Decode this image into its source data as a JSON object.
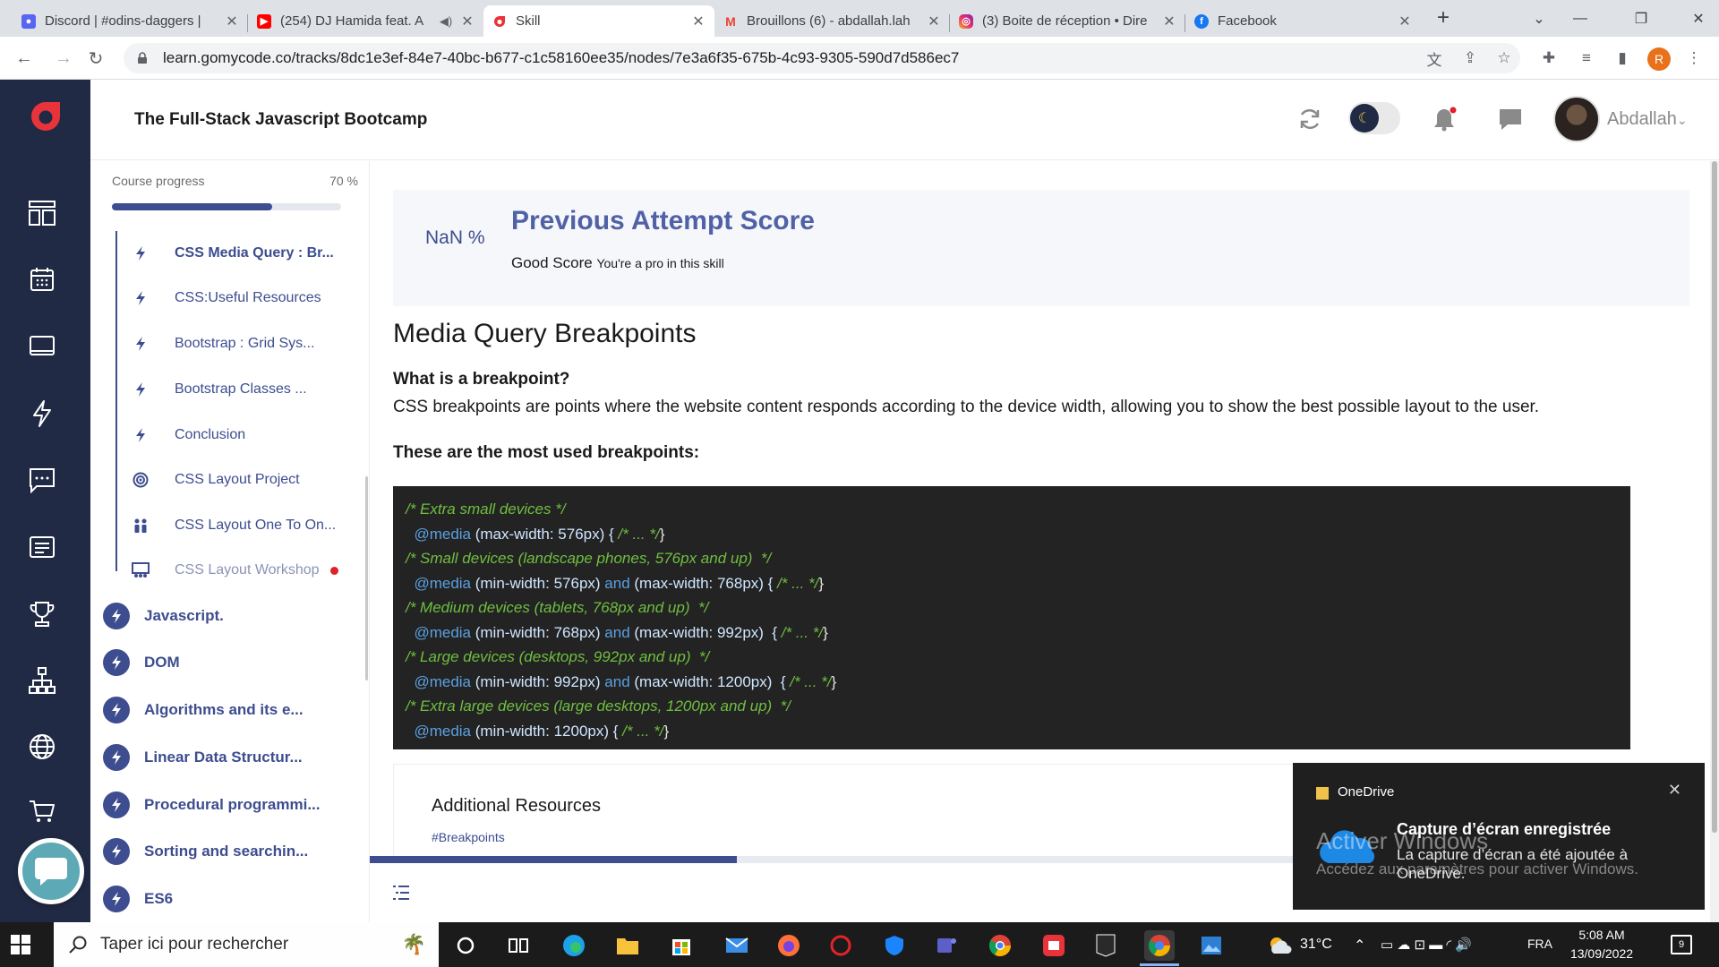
{
  "browser": {
    "tabs": [
      {
        "title": "Discord | #odins-daggers | ",
        "icon": "discord-icon"
      },
      {
        "title": "(254) DJ Hamida feat. A",
        "icon": "youtube-icon"
      },
      {
        "title": "Skill",
        "icon": "gomycode-icon"
      },
      {
        "title": "Brouillons (6) - abdallah.lah",
        "icon": "gmail-icon"
      },
      {
        "title": "(3) Boite de réception • Dire",
        "icon": "instagram-icon"
      },
      {
        "title": "Facebook",
        "icon": "facebook-icon"
      }
    ],
    "url": "learn.gomycode.co/tracks/8dc1e3ef-84e7-40bc-b677-c1c58160ee35/nodes/7e3a6f35-675b-4c93-9305-590d7d586ec7",
    "profile_initial": "R"
  },
  "header": {
    "course_title": "The Full-Stack Javascript Bootcamp",
    "user_name": "Abdallah"
  },
  "sidebar": {
    "progress_label": "Course progress",
    "progress_text": "70 %",
    "progress_value": 0.7,
    "sub_items": [
      {
        "label": "CSS Media Query : Br...",
        "icon": "bolt-icon",
        "current": true
      },
      {
        "label": "CSS:Useful Resources",
        "icon": "bolt-icon"
      },
      {
        "label": "Bootstrap : Grid Sys...",
        "icon": "bolt-icon"
      },
      {
        "label": "Bootstrap Classes ...",
        "icon": "bolt-icon"
      },
      {
        "label": "Conclusion",
        "icon": "bolt-icon"
      },
      {
        "label": "CSS Layout Project",
        "icon": "target-icon"
      },
      {
        "label": "CSS Layout One To On...",
        "icon": "people-icon"
      },
      {
        "label": "CSS Layout Workshop",
        "icon": "workshop-icon",
        "muted": true
      }
    ],
    "chapters": [
      "Javascript.",
      "DOM",
      "Algorithms and its e...",
      "Linear Data Structur...",
      "Procedural programmi...",
      "Sorting and searchin...",
      "ES6"
    ]
  },
  "score": {
    "percent": "NaN %",
    "title": "Previous Attempt Score",
    "rating": "Good Score",
    "message": "You're a pro in this skill"
  },
  "content": {
    "heading": "Media Query Breakpoints",
    "question": "What is a breakpoint?",
    "paragraph": "CSS breakpoints are points where the website content responds according to the device width, allowing you to show the best possible layout to the user.",
    "subheading": "These are the most used breakpoints:",
    "code": {
      "c1": "/* Extra small devices */",
      "m1": "@media",
      "p1": " (max-width: 576px) { ",
      "e1": "/* ... */",
      "c2": "/* Small devices (landscape phones, 576px and up)  */",
      "m2": "@media",
      "p2a": " (min-width: 576px) ",
      "and": "and",
      "p2b": " (max-width: 768px) { ",
      "e2": "/* ... */",
      "c3": "/* Medium devices (tablets, 768px and up)  */",
      "p3a": " (min-width: 768px) ",
      "p3b": " (max-width: 992px)  { ",
      "c4": "/* Large devices (desktops, 992px and up)  */",
      "p4a": " (min-width: 992px) ",
      "p4b": " (max-width: 1200px)  { ",
      "c5": "/* Extra large devices (large desktops, 1200px and up)  */",
      "p5": " (min-width: 1200px) { ",
      "close": "}"
    },
    "resources_title": "Additional Resources",
    "resources_tag": "#Breakpoints",
    "page_progress_value": 0.275
  },
  "toast": {
    "app": "OneDrive",
    "title": "Capture d’écran enregistrée",
    "body": "La capture d’écran a été ajoutée à OneDrive.",
    "watermark_title": "Activer Windows",
    "watermark_body": "Accédez aux paramètres pour activer Windows."
  },
  "taskbar": {
    "search_placeholder": "Taper ici pour rechercher",
    "temperature": "31°C",
    "language": "FRA",
    "time": "5:08 AM",
    "date": "13/09/2022",
    "notification_count": "9"
  },
  "colors": {
    "brand_navy": "#202a44",
    "accent": "#3d4d8f",
    "score_title": "#5061a8",
    "logo_red": "#e8333b"
  }
}
